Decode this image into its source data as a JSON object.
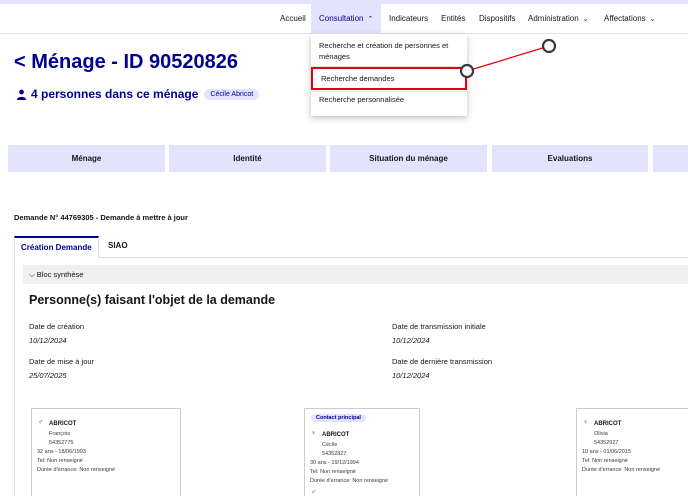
{
  "nav": {
    "items": [
      "Accueil",
      "Consultation",
      "Indicateurs",
      "Entités",
      "Dispositifs",
      "Administration",
      "Affectations"
    ]
  },
  "dropdown": {
    "items": [
      "Recherche et création de personnes et ménages",
      "Recherche demandes",
      "Recherche personnalisée"
    ]
  },
  "header": {
    "title": "< Ménage - ID 90520826",
    "persons": "4 personnes dans ce ménage",
    "badge": "Cécile Abricot"
  },
  "blocks": [
    "Ménage",
    "Identité",
    "Situation du ménage",
    "Evaluations"
  ],
  "demande": "Demande N° 44769305 - Demande à mettre à jour",
  "tabs": [
    "Création Demande",
    "SIAO"
  ],
  "bloc_synthese": "Bloc synthèse",
  "section_title": "Personne(s) faisant l'objet de la demande",
  "fields": {
    "creation_label": "Date de création",
    "creation_val": "10/12/2024",
    "transmission_initiale_label": "Date de transmission initiale",
    "transmission_initiale_val": "10/12/2024",
    "maj_label": "Date de mise à jour",
    "maj_val": "25/07/2025",
    "derniere_transmission_label": "Date de dernière transmission",
    "derniere_transmission_val": "10/12/2024"
  },
  "cards": [
    {
      "name": "ABRICOT",
      "first": "François",
      "id": "54352775",
      "age": "32 ans - 18/06/1993",
      "tel": "Tel: Non renseigné",
      "errance": "Durée d'errance: Non renseigné"
    },
    {
      "badge": "Contact principal",
      "name": "ABRICOT",
      "first": "Cécile",
      "id": "54352827",
      "age": "30 ans - 19/12/1994",
      "tel": "Tel: Non renseigné",
      "errance": "Durée d'errance: Non renseigné"
    },
    {
      "name": "ABRICOT",
      "first": "Olivia",
      "id": "54352927",
      "age": "10 ans - 01/06/2015",
      "tel": "Tel: Non renseigné",
      "errance": "Durée d'errance: Non renseigné"
    }
  ]
}
